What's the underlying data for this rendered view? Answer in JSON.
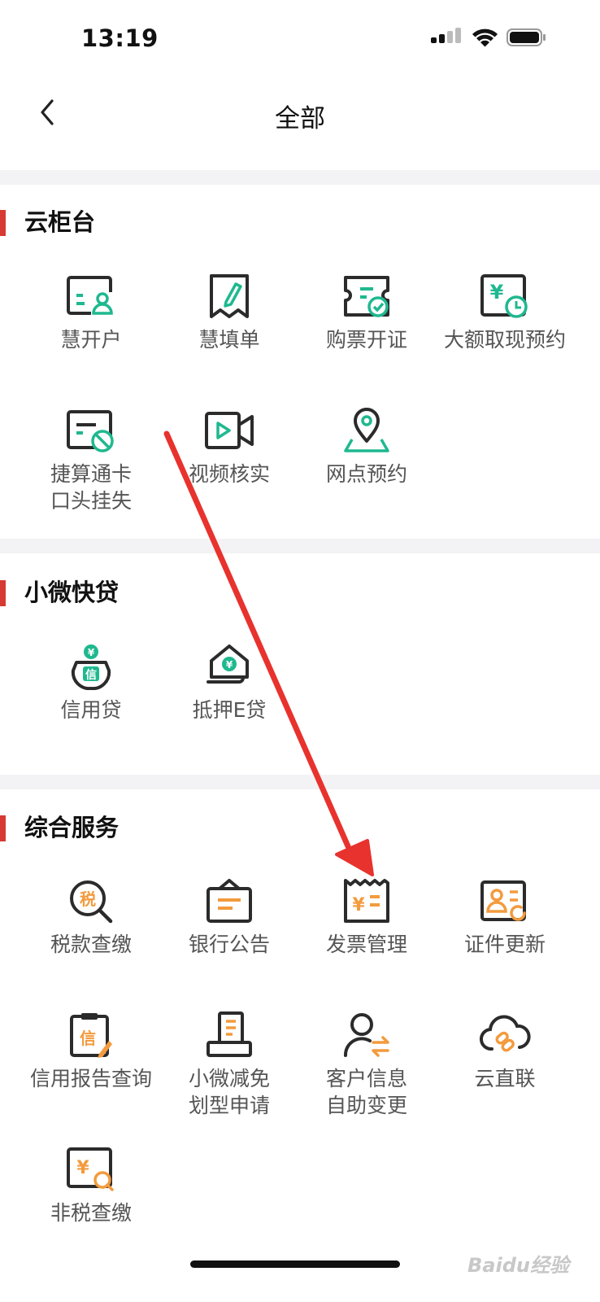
{
  "status_bar": {
    "time": "13:19"
  },
  "nav": {
    "title": "全部"
  },
  "sections": [
    {
      "title": "云柜台",
      "items": [
        {
          "label": "慧开户"
        },
        {
          "label": "慧填单"
        },
        {
          "label": "购票开证"
        },
        {
          "label": "大额取现预约"
        },
        {
          "label": "捷算通卡\n口头挂失"
        },
        {
          "label": "视频核实"
        },
        {
          "label": "网点预约"
        }
      ]
    },
    {
      "title": "小微快贷",
      "items": [
        {
          "label": "信用贷"
        },
        {
          "label": "抵押E贷"
        }
      ]
    },
    {
      "title": "综合服务",
      "items": [
        {
          "label": "税款查缴"
        },
        {
          "label": "银行公告"
        },
        {
          "label": "发票管理"
        },
        {
          "label": "证件更新"
        },
        {
          "label": "信用报告查询"
        },
        {
          "label": "小微减免\n划型申请"
        },
        {
          "label": "客户信息\n自助变更"
        },
        {
          "label": "云直联"
        },
        {
          "label": "非税查缴"
        }
      ]
    }
  ],
  "icon_glyphs": {
    "yuan": "¥",
    "tax": "税",
    "credit": "信"
  },
  "colors": {
    "green": "#1fb88f",
    "orange": "#f39b3e",
    "dark": "#2b2b2b",
    "accent_red": "#d63a33",
    "arrow": "#e8322d"
  },
  "watermark": "Baidu经验"
}
